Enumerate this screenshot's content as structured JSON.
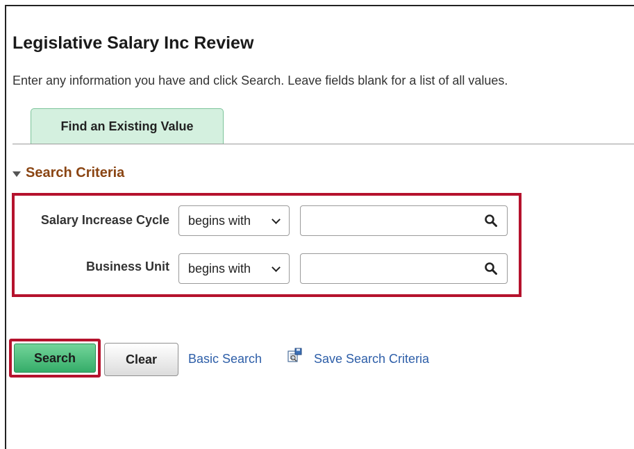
{
  "page": {
    "title": "Legislative Salary Inc Review",
    "instructions": "Enter any information you have and click Search. Leave fields blank for a list of all values."
  },
  "tabs": [
    {
      "label": "Find an Existing Value",
      "active": true
    }
  ],
  "search_criteria": {
    "header": "Search Criteria",
    "fields": [
      {
        "label": "Salary Increase Cycle",
        "operator": "begins with",
        "value": "",
        "icon": "magnifier-icon"
      },
      {
        "label": "Business Unit",
        "operator": "begins with",
        "value": "",
        "icon": "magnifier-icon"
      }
    ]
  },
  "actions": {
    "search_label": "Search",
    "clear_label": "Clear",
    "basic_search_label": "Basic Search",
    "save_criteria_label": "Save Search Criteria",
    "save_criteria_icon": "save-criteria-icon"
  },
  "colors": {
    "highlight": "#b5122d",
    "tab_background": "#d4f0df",
    "search_button": "#35ad69",
    "section_header": "#8a4513",
    "link": "#2d5ea8"
  }
}
